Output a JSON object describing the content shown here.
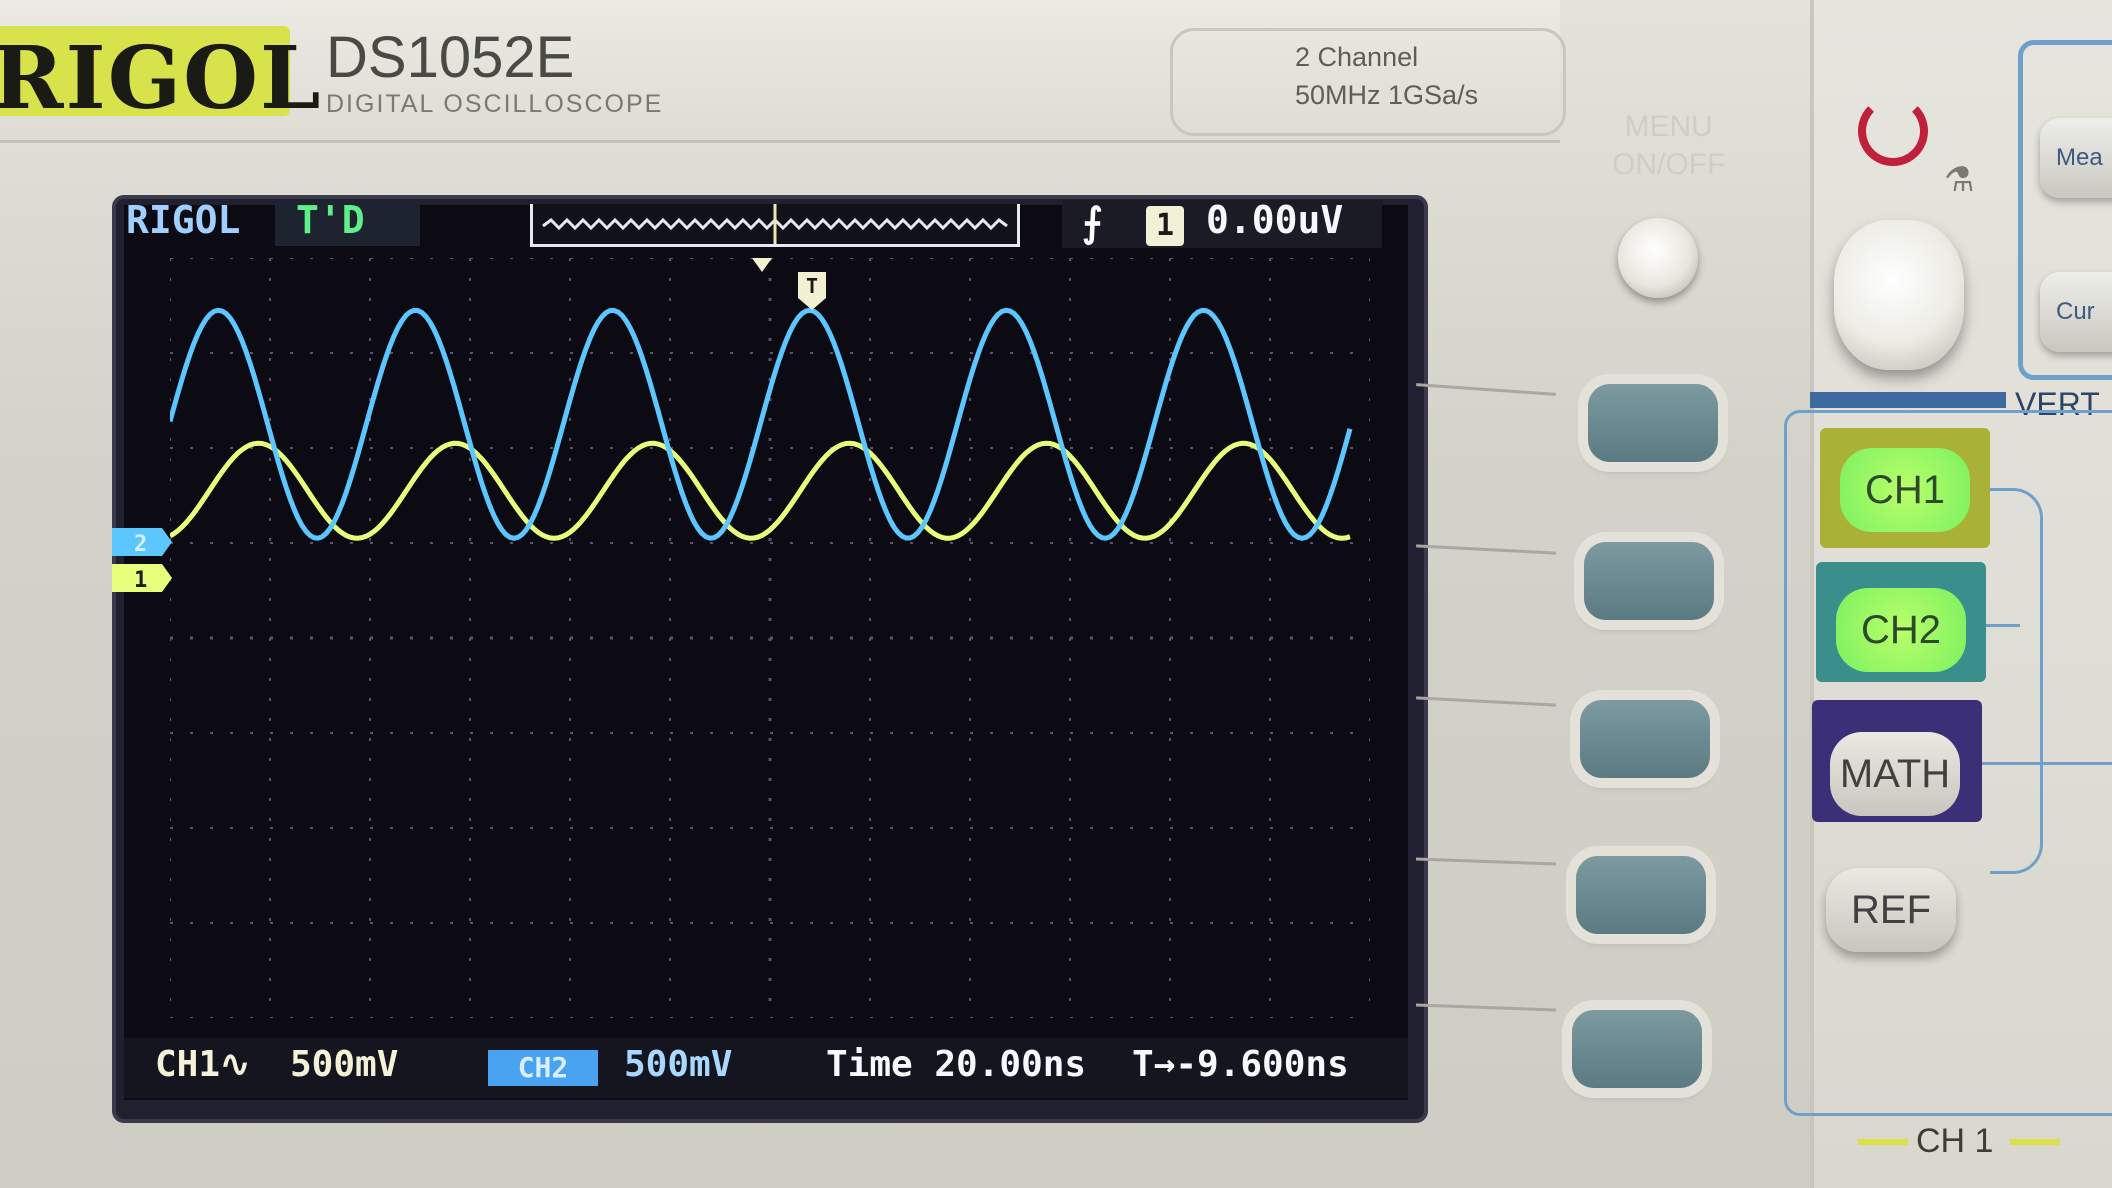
{
  "device": {
    "brand": "RIGOL",
    "model": "DS1052E",
    "subtitle": "DIGITAL OSCILLOSCOPE",
    "spec_line1": "2 Channel",
    "spec_line2": "50MHz 1GSa/s"
  },
  "screen": {
    "brand": "RIGOL",
    "acq_status": "T'D",
    "trigger_source": "1",
    "trigger_level": "0.00uV",
    "edge_icon": "rising-edge-icon",
    "footer": {
      "ch1_label": "CH1∿",
      "ch1_scale": "500mV",
      "ch2_label": "CH2",
      "ch2_scale": "500mV",
      "timebase": "Time 20.00ns",
      "trigger_offset": "T→-9.600ns"
    },
    "markers": {
      "ch2_marker": "2",
      "ch1_marker": "1",
      "trigger_marker": "T"
    },
    "colors": {
      "ch1": "#e6ff7a",
      "ch2": "#5cc6ff",
      "grid": "#5a5370"
    },
    "traces": {
      "grid_divisions": {
        "x": 12,
        "y": 8
      },
      "ch1": {
        "period_div": 1.97,
        "amplitude_div": 0.5
      },
      "ch2": {
        "period_div": 1.97,
        "amplitude_div": 1.2
      }
    }
  },
  "controls": {
    "menu_label_line1": "MENU",
    "menu_label_line2": "ON/OFF",
    "softkeys": [
      "",
      "",
      "",
      "",
      ""
    ],
    "meas_buttons": [
      "Mea",
      "Cur"
    ],
    "vertical_label": "VERT",
    "ch1_button": "CH1",
    "ch2_button": "CH2",
    "math_button": "MATH",
    "ref_button": "REF",
    "ch1_knob_label": "CH 1",
    "run_icon": "refresh-arrow-icon",
    "multi_knob_icon": "probe-icon"
  }
}
